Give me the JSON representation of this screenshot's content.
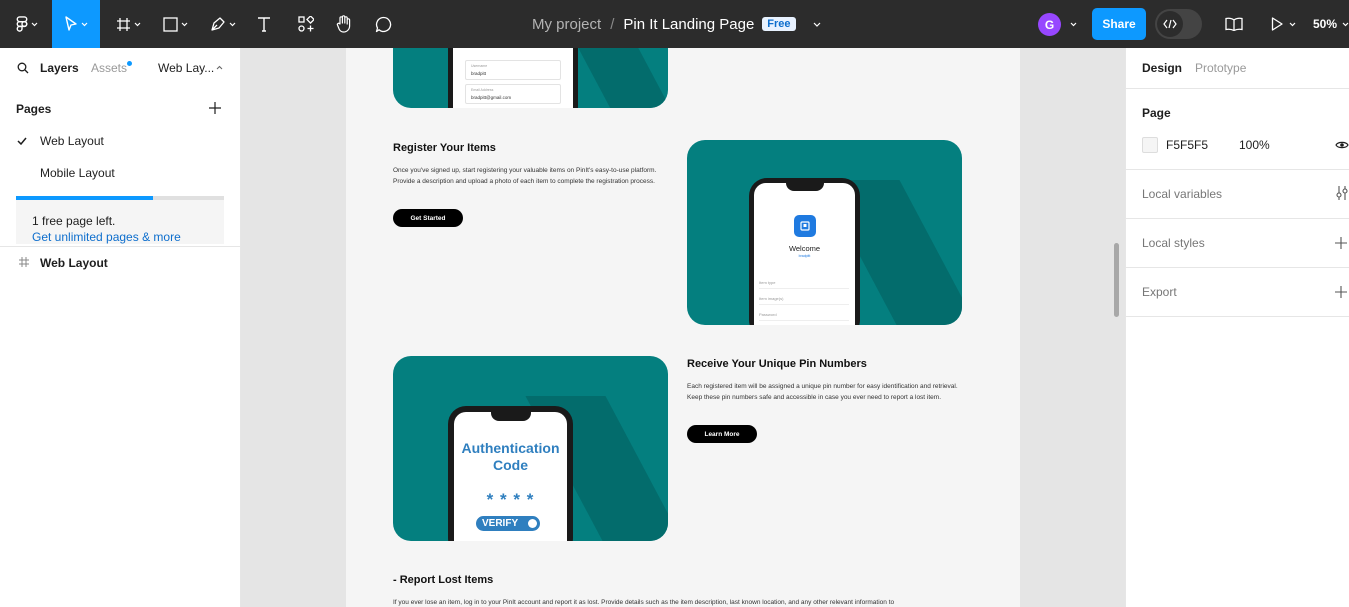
{
  "toolbar": {
    "project": "My project",
    "separator": "/",
    "file_name": "Pin It Landing Page",
    "plan_badge": "Free",
    "avatar_initial": "G",
    "share_label": "Share",
    "zoom": "50%"
  },
  "left_panel": {
    "tabs": {
      "layers": "Layers",
      "assets": "Assets",
      "page_selector": "Web Lay..."
    },
    "pages_title": "Pages",
    "pages": [
      {
        "label": "Web Layout",
        "selected": true
      },
      {
        "label": "Mobile Layout",
        "selected": false
      }
    ],
    "upsell": {
      "progress": 0.66,
      "text": "1 free page left.",
      "link": "Get unlimited pages & more"
    },
    "layers": [
      {
        "label": "Web Layout",
        "icon": "frame-icon"
      }
    ]
  },
  "canvas": {
    "top_phone": {
      "field1_label": "Username",
      "field1_value": "bradpitt",
      "field2_label": "Email Address",
      "field2_value": "bradpitt@gmail.com"
    },
    "sections": [
      {
        "heading": "Register Your Items",
        "body": "Once you've signed up, start registering your valuable items on PinIt's easy-to-use platform. Provide a description and upload a photo of each item to complete the registration process.",
        "button": "Get Started"
      },
      {
        "heading": "Receive Your Unique Pin Numbers",
        "body": "Each registered item will be assigned a unique pin number for easy identification and retrieval. Keep these pin numbers safe and accessible in case you ever need to report a lost item.",
        "button": "Learn More"
      },
      {
        "heading": "- Report Lost Items",
        "body": "If you ever lose an item, log in to your PinIt account and report it as lost. Provide details such as the item description, last known location, and any other relevant information to"
      }
    ],
    "welcome_phone": {
      "title": "Welcome",
      "subtitle": "bradpitt",
      "rows": [
        "Item type",
        "Item image(s)",
        "Password"
      ]
    },
    "auth_phone": {
      "title_line1": "Authentication",
      "title_line2": "Code",
      "code_mask": "* * * *",
      "verify_label": "VERIFY"
    }
  },
  "right_panel": {
    "tabs": {
      "design": "Design",
      "prototype": "Prototype"
    },
    "page_section": "Page",
    "bg_color": "F5F5F5",
    "bg_opacity": "100%",
    "local_variables": "Local variables",
    "local_styles": "Local styles",
    "export": "Export"
  },
  "colors": {
    "accent": "#0d99ff",
    "toolbar_bg": "#2c2c2c",
    "teal": "#047f7f",
    "avatar": "#9747ff"
  }
}
